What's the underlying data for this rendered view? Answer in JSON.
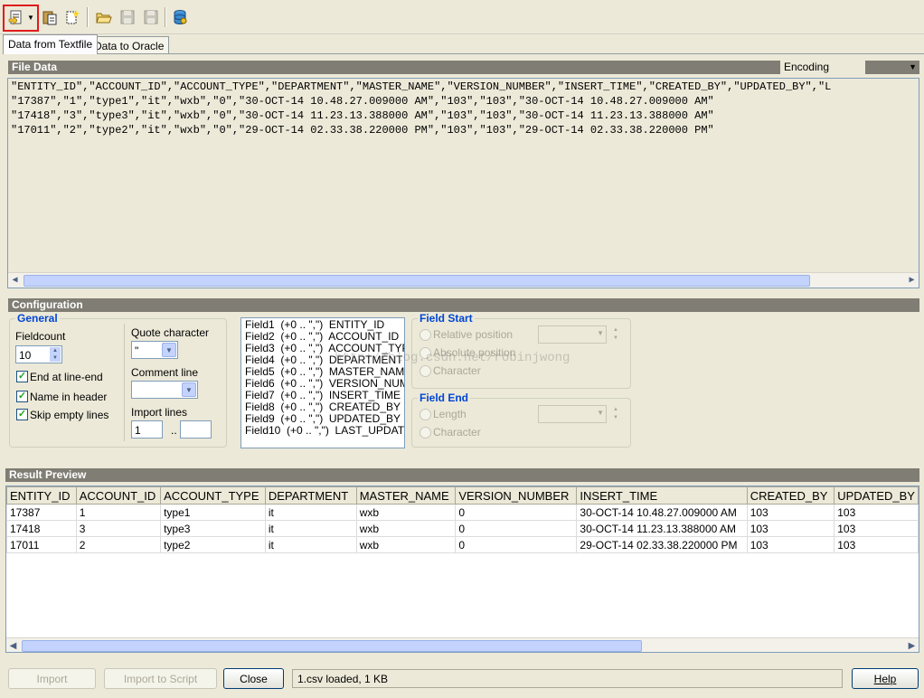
{
  "tabs": [
    {
      "label": "Data from Textfile",
      "active": true
    },
    {
      "label": "Data to Oracle",
      "active": false
    }
  ],
  "toolbar": {
    "icons": [
      "open-file-dropdown-icon",
      "paste-icon",
      "new-icon",
      "open-folder-icon",
      "save-icon",
      "save-as-icon",
      "database-icon"
    ]
  },
  "file_data": {
    "header": "File Data",
    "encoding_label": "Encoding",
    "lines": [
      "\"ENTITY_ID\",\"ACCOUNT_ID\",\"ACCOUNT_TYPE\",\"DEPARTMENT\",\"MASTER_NAME\",\"VERSION_NUMBER\",\"INSERT_TIME\",\"CREATED_BY\",\"UPDATED_BY\",\"L",
      "\"17387\",\"1\",\"type1\",\"it\",\"wxb\",\"0\",\"30-OCT-14 10.48.27.009000 AM\",\"103\",\"103\",\"30-OCT-14 10.48.27.009000 AM\"",
      "\"17418\",\"3\",\"type3\",\"it\",\"wxb\",\"0\",\"30-OCT-14 11.23.13.388000 AM\",\"103\",\"103\",\"30-OCT-14 11.23.13.388000 AM\"",
      "\"17011\",\"2\",\"type2\",\"it\",\"wxb\",\"0\",\"29-OCT-14 02.33.38.220000 PM\",\"103\",\"103\",\"29-OCT-14 02.33.38.220000 PM\""
    ]
  },
  "configuration": {
    "header": "Configuration",
    "general_title": "General",
    "fieldcount_label": "Fieldcount",
    "fieldcount_value": "10",
    "end_at_line_end": "End at line-end",
    "name_in_header": "Name in header",
    "skip_empty_lines": "Skip empty lines",
    "quote_char_label": "Quote character",
    "quote_char_value": "\"",
    "comment_line_label": "Comment line",
    "import_lines_label": "Import lines",
    "import_from": "1",
    "import_sep": "..",
    "fields": [
      "Field1  (+0 .. \",\")  ENTITY_ID",
      "Field2  (+0 .. \",\")  ACCOUNT_ID",
      "Field3  (+0 .. \",\")  ACCOUNT_TYPE",
      "Field4  (+0 .. \",\")  DEPARTMENT",
      "Field5  (+0 .. \",\")  MASTER_NAME",
      "Field6  (+0 .. \",\")  VERSION_NUMBE",
      "Field7  (+0 .. \",\")  INSERT_TIME",
      "Field8  (+0 .. \",\")  CREATED_BY",
      "Field9  (+0 .. \",\")  UPDATED_BY",
      "Field10  (+0 .. \",\")  LAST_UPDATE_T"
    ],
    "field_start_title": "Field Start",
    "relative_position": "Relative position",
    "absolute_position": "Absolute position",
    "character": "Character",
    "field_end_title": "Field End",
    "length": "Length",
    "character_end": "Character",
    "watermark": "http://blog.csdn.net/robinjwong"
  },
  "result_preview": {
    "header": "Result Preview",
    "columns": [
      "ENTITY_ID",
      "ACCOUNT_ID",
      "ACCOUNT_TYPE",
      "DEPARTMENT",
      "MASTER_NAME",
      "VERSION_NUMBER",
      "INSERT_TIME",
      "CREATED_BY",
      "UPDATED_BY"
    ],
    "rows": [
      [
        "17387",
        "1",
        "type1",
        "it",
        "wxb",
        "0",
        "30-OCT-14 10.48.27.009000 AM",
        "103",
        "103"
      ],
      [
        "17418",
        "3",
        "type3",
        "it",
        "wxb",
        "0",
        "30-OCT-14 11.23.13.388000 AM",
        "103",
        "103"
      ],
      [
        "17011",
        "2",
        "type2",
        "it",
        "wxb",
        "0",
        "29-OCT-14 02.33.38.220000 PM",
        "103",
        "103"
      ]
    ]
  },
  "buttons": {
    "import": "Import",
    "import_to_script": "Import to Script",
    "close": "Close",
    "help": "Help"
  },
  "status": "1.csv loaded,  1 KB"
}
